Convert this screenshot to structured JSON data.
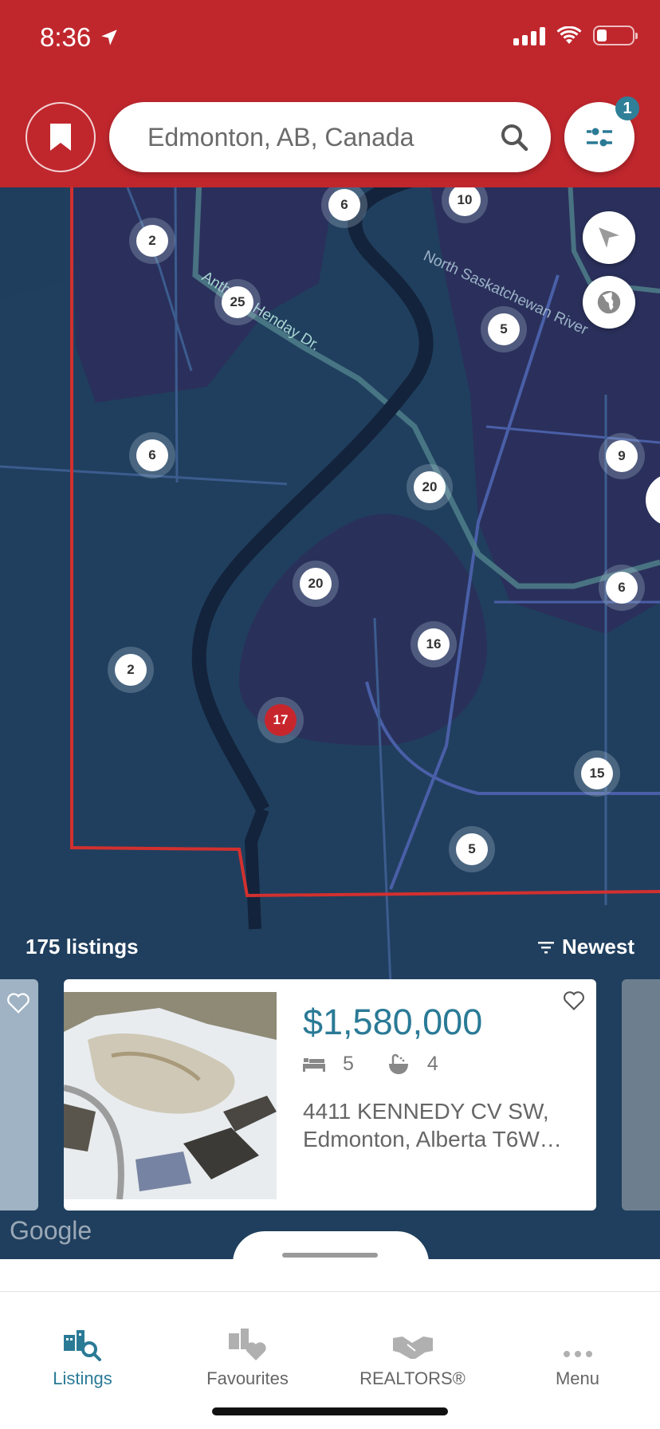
{
  "status_bar": {
    "time": "8:36"
  },
  "search": {
    "value": "Edmonton, AB, Canada"
  },
  "filter": {
    "badge_count": "1"
  },
  "map": {
    "road_labels": [
      "North Saskatchewan River",
      "Anthony Henday Dr."
    ],
    "clusters": [
      "6",
      "10",
      "2",
      "25",
      "5",
      "6",
      "9",
      "20",
      "20",
      "6",
      "16",
      "2",
      "17",
      "15",
      "5"
    ],
    "active_cluster": "17"
  },
  "results": {
    "count_label": "175 listings",
    "sort_label": "Newest"
  },
  "listing": {
    "price": "$1,580,000",
    "bedrooms": "5",
    "bathrooms": "4",
    "address_line1": "4411 KENNEDY CV SW,",
    "address_line2": "Edmonton, Alberta T6W…"
  },
  "branding": {
    "map_provider": "Google"
  },
  "tabs": [
    {
      "label": "Listings",
      "icon": "listings-search-icon",
      "active": true
    },
    {
      "label": "Favourites",
      "icon": "favourites-icon",
      "active": false
    },
    {
      "label": "REALTORS®",
      "icon": "handshake-icon",
      "active": false
    },
    {
      "label": "Menu",
      "icon": "more-dots-icon",
      "active": false
    }
  ],
  "colors": {
    "brand_red": "#c0272d",
    "accent_teal": "#2a7a96",
    "map_bg": "#203f5e"
  }
}
